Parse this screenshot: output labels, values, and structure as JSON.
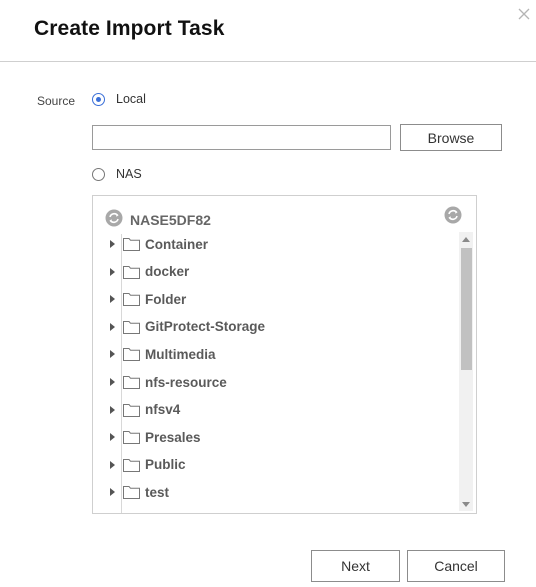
{
  "dialog": {
    "title": "Create Import Task"
  },
  "source": {
    "label": "Source",
    "options": [
      {
        "label": "Local",
        "selected": true
      },
      {
        "label": "NAS",
        "selected": false
      }
    ],
    "path_value": "",
    "browse_label": "Browse"
  },
  "tree": {
    "root": "NASE5DF82",
    "folders": [
      "Container",
      "docker",
      "Folder",
      "GitProtect-Storage",
      "Multimedia",
      "nfs-resource",
      "nfsv4",
      "Presales",
      "Public",
      "test"
    ]
  },
  "footer": {
    "next_label": "Next",
    "cancel_label": "Cancel"
  },
  "icons": {
    "close": "close-icon",
    "radio": "radio-icon",
    "folder": "folder-icon",
    "expand": "chevron-right-icon",
    "refresh": "refresh-icon",
    "root": "nas-sync-icon"
  },
  "colors": {
    "accent": "#3a6fd8",
    "folder_text": "#5a5a5a"
  }
}
